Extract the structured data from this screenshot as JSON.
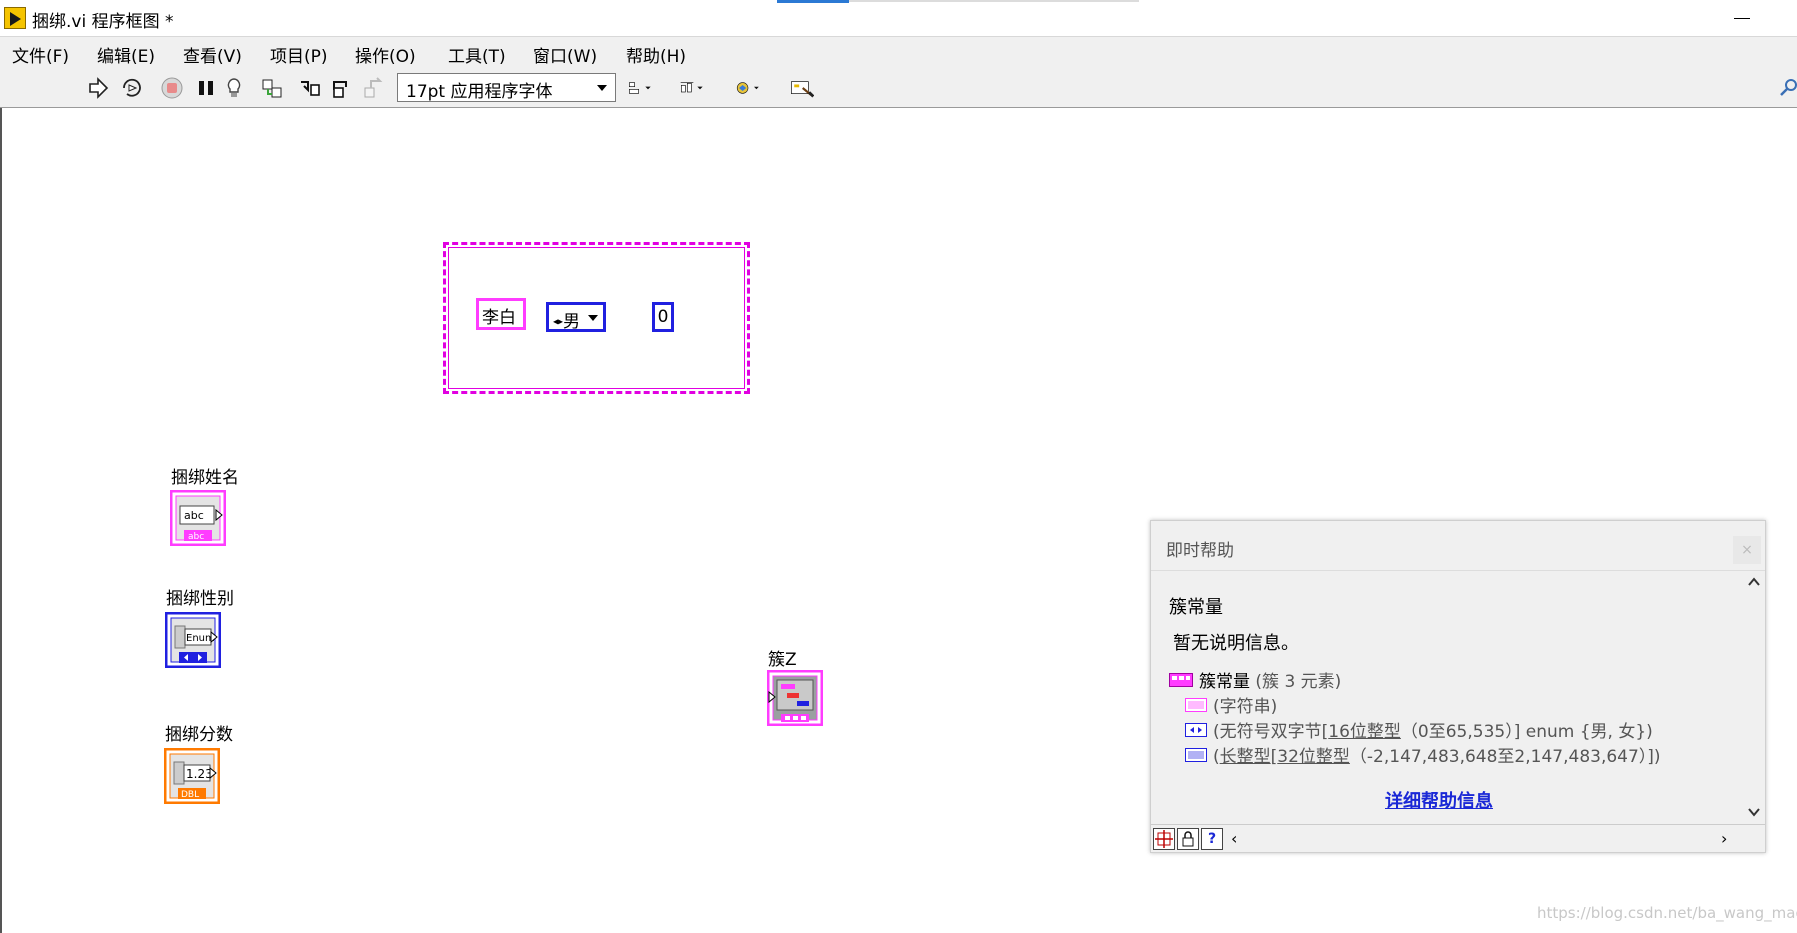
{
  "window": {
    "title": "捆绑.vi 程序框图 *"
  },
  "menu": [
    {
      "label": "文件(F)"
    },
    {
      "label": "编辑(E)"
    },
    {
      "label": "查看(V)"
    },
    {
      "label": "项目(P)"
    },
    {
      "label": "操作(O)"
    },
    {
      "label": "工具(T)"
    },
    {
      "label": "窗口(W)"
    },
    {
      "label": "帮助(H)"
    }
  ],
  "toolbar": {
    "font": "17pt 应用程序字体"
  },
  "diagram": {
    "cluster_constant": {
      "string_value": "李白",
      "enum_value": "男",
      "number_value": "0"
    },
    "terminals": {
      "name_label": "捆绑姓名",
      "name_icon_text": "abc",
      "gender_label": "捆绑性别",
      "gender_icon_text": "Enum",
      "score_label": "捆绑分数",
      "score_icon_text": "1.23",
      "score_type_text": "DBL",
      "cluster_label": "簇Z"
    }
  },
  "help": {
    "title": "即时帮助",
    "name": "簇常量",
    "description": "暂无说明信息。",
    "type_name": "簇常量",
    "type_detail": " (簇 3 元素)",
    "element_string": "(字符串)",
    "element_enum_prefix": "(无符号双字节[",
    "element_enum_link": "16位整型",
    "element_enum_suffix": "（0至65,535）] enum {男, 女})",
    "element_int_prefix": "(",
    "element_int_link": "长整型",
    "element_int_middle": "[",
    "element_int_link2": "32位整型",
    "element_int_suffix": "（-2,147,483,648至2,147,483,647）])",
    "detail_link": "详细帮助信息",
    "close_glyph": "×"
  },
  "watermark": "https://blog.csdn.net/ba_wang_mao",
  "colors": {
    "string": "#ff3cff",
    "enum": "#2020e0",
    "dbl": "#ff7a00",
    "link": "#1a28d6"
  }
}
